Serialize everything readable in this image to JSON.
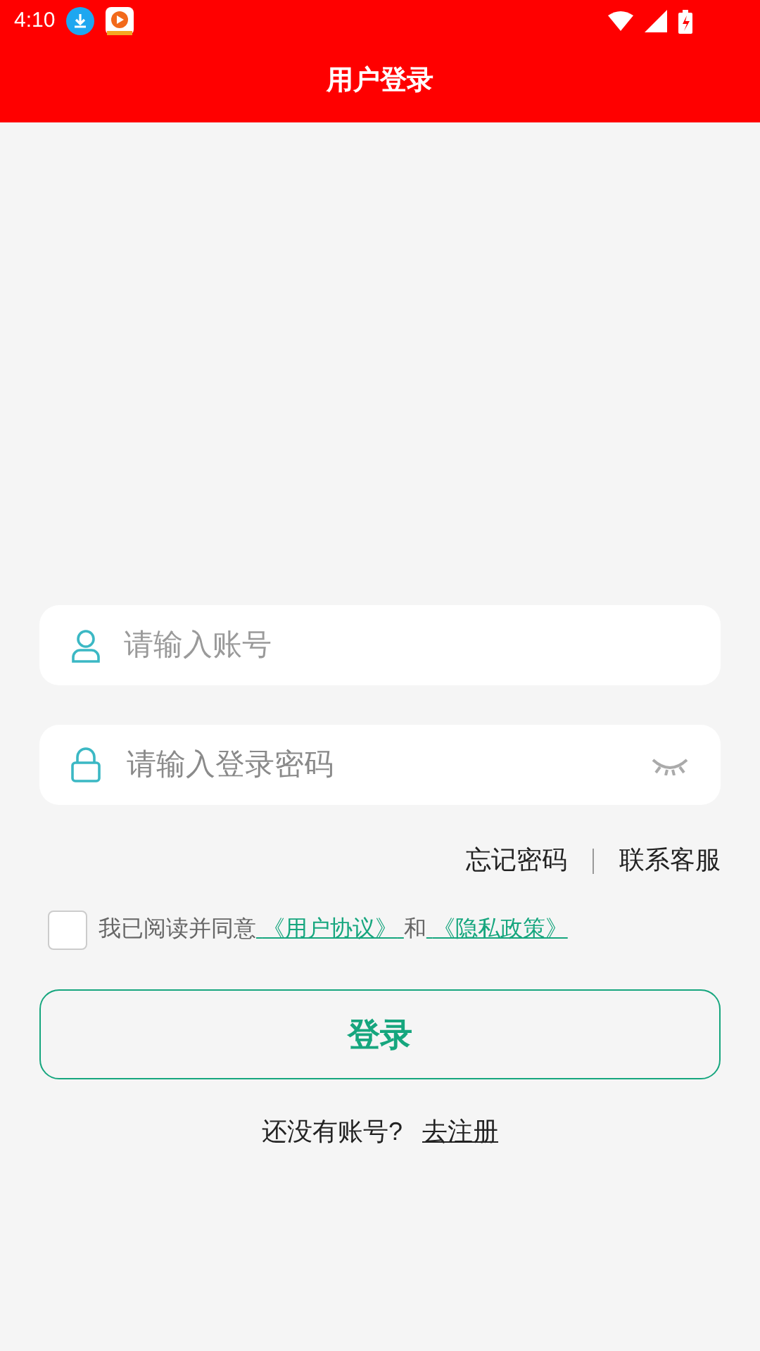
{
  "status_bar": {
    "time": "4:10"
  },
  "header": {
    "title": "用户登录"
  },
  "account_field": {
    "placeholder": "请输入账号"
  },
  "password_field": {
    "placeholder": "请输入登录密码"
  },
  "links": [
    "忘记密码",
    "联系客服"
  ],
  "agreement": {
    "checked": false,
    "prefix": "我已阅读并同意",
    "link_1": "《用户协议》",
    "middle": "和",
    "link_2": "《隐私政策》"
  },
  "login_button": "登录",
  "register": {
    "prompt": "还没有账号?",
    "link": "去注册"
  }
}
